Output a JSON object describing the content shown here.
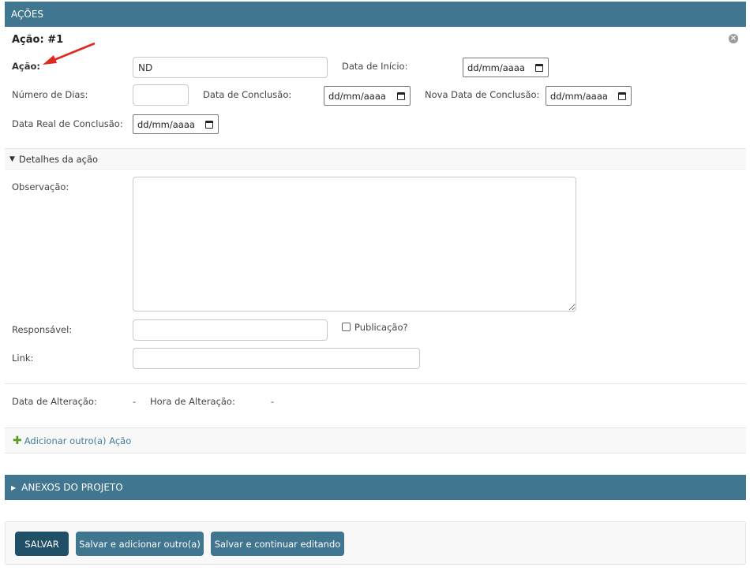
{
  "acoes": {
    "header": "AÇÕES",
    "inline_title": "Ação: #1",
    "delete_glyph": "×",
    "acao_label": "Ação:",
    "acao_value": "ND",
    "data_inicio_label": "Data de Início:",
    "date_placeholder": "dd/mm/aaaa",
    "numero_dias_label": "Número de Dias:",
    "data_conclusao_label": "Data de Conclusão:",
    "nova_data_conclusao_label": "Nova Data de Conclusão:",
    "data_real_conclusao_label": "Data Real de Conclusão:",
    "details_toggle": "Detalhes da ação",
    "details_glyph": "▼",
    "observacao_label": "Observação:",
    "responsavel_label": "Responsável:",
    "publicacao_label": "Publicação?",
    "link_label": "Link:",
    "data_alteracao_label": "Data de Alteração:",
    "data_alteracao_value": "-",
    "hora_alteracao_label": "Hora de Alteração:",
    "hora_alteracao_value": "-",
    "add_glyph": "✚",
    "add_link": "Adicionar outro(a) Ação"
  },
  "anexos": {
    "header": "ANEXOS DO PROJETO",
    "glyph": "▶"
  },
  "buttons": {
    "salvar": "SALVAR",
    "salvar_adicionar": "Salvar e adicionar outro(a)",
    "salvar_continuar": "Salvar e continuar editando"
  },
  "colors": {
    "header_bg": "#417690",
    "primary_button": "#205067",
    "arrow": "#e0281f",
    "add_icon": "#5b9b1f"
  },
  "icons": [
    "close-icon",
    "calendar-icon",
    "plus-icon",
    "red-arrow-annotation"
  ]
}
